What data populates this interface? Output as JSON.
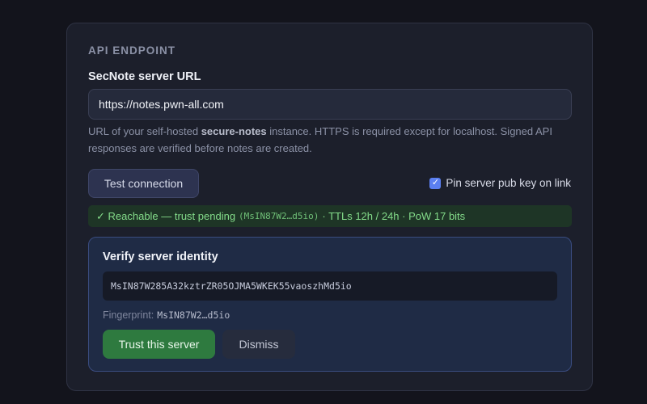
{
  "section": {
    "title": "API ENDPOINT"
  },
  "server_url": {
    "label": "SecNote server URL",
    "value": "https://notes.pwn-all.com"
  },
  "help": {
    "prefix": "URL of your self-hosted ",
    "emphasis": "secure-notes",
    "suffix": " instance. HTTPS is required except for localhost. Signed API responses are verified before notes are created."
  },
  "actions": {
    "test_label": "Test connection"
  },
  "pin": {
    "label": "Pin server pub key on link",
    "checked": true,
    "check_glyph": "✓"
  },
  "status": {
    "text": "✓ Reachable — trust pending",
    "fingerprint": "(MsIN87W2…d5io)",
    "details": "· TTLs 12h / 24h · PoW 17 bits",
    "color": "#84dc8a"
  },
  "verify": {
    "title": "Verify server identity",
    "public_key": "MsIN87W285A32kztrZR05OJMA5WKEK55vaoszhMd5io",
    "fingerprint_label": "Fingerprint:",
    "fingerprint_value": "MsIN87W2…d5io",
    "trust_label": "Trust this server",
    "dismiss_label": "Dismiss"
  },
  "colors": {
    "accent": "#5b7ff0",
    "success": "#2e7a3f",
    "panel_border": "#3a4c80"
  }
}
